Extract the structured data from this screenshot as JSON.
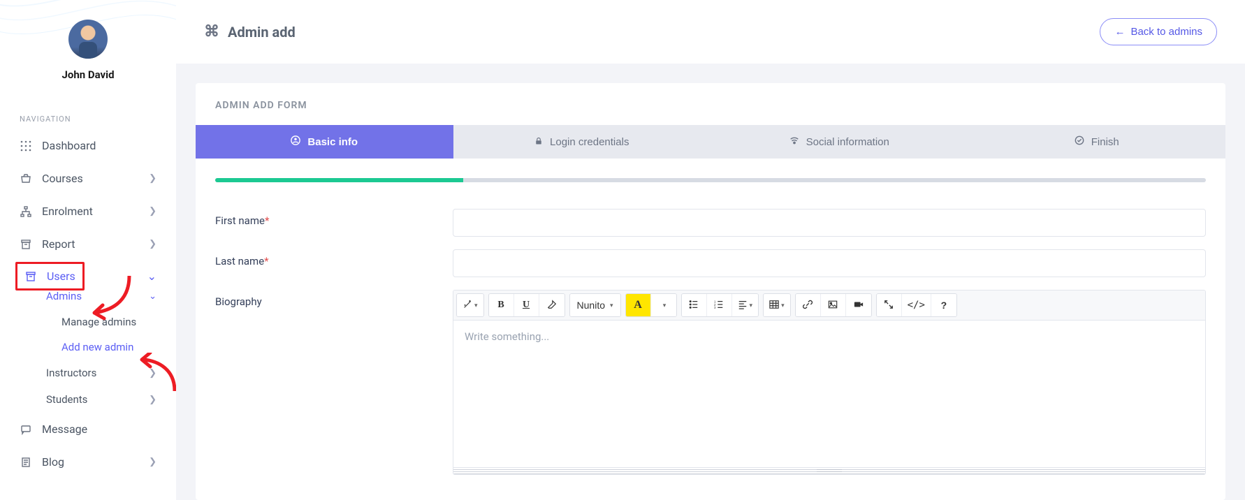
{
  "user": {
    "name": "John David"
  },
  "sidebar": {
    "section": "NAVIGATION",
    "items": {
      "dashboard": "Dashboard",
      "courses": "Courses",
      "enrolment": "Enrolment",
      "report": "Report",
      "users": "Users",
      "message": "Message",
      "blog": "Blog"
    },
    "users_sub": {
      "admins": "Admins",
      "manage_admins": "Manage admins",
      "add_new_admin": "Add new admin",
      "instructors": "Instructors",
      "students": "Students"
    }
  },
  "header": {
    "title": "Admin add",
    "back": "Back to admins"
  },
  "card": {
    "title": "ADMIN ADD FORM"
  },
  "tabs": {
    "basic": "Basic info",
    "login": "Login credentials",
    "social": "Social information",
    "finish": "Finish"
  },
  "form": {
    "first_name": "First name",
    "last_name": "Last name",
    "biography": "Biography"
  },
  "editor": {
    "font": "Nunito",
    "placeholder": "Write something..."
  }
}
